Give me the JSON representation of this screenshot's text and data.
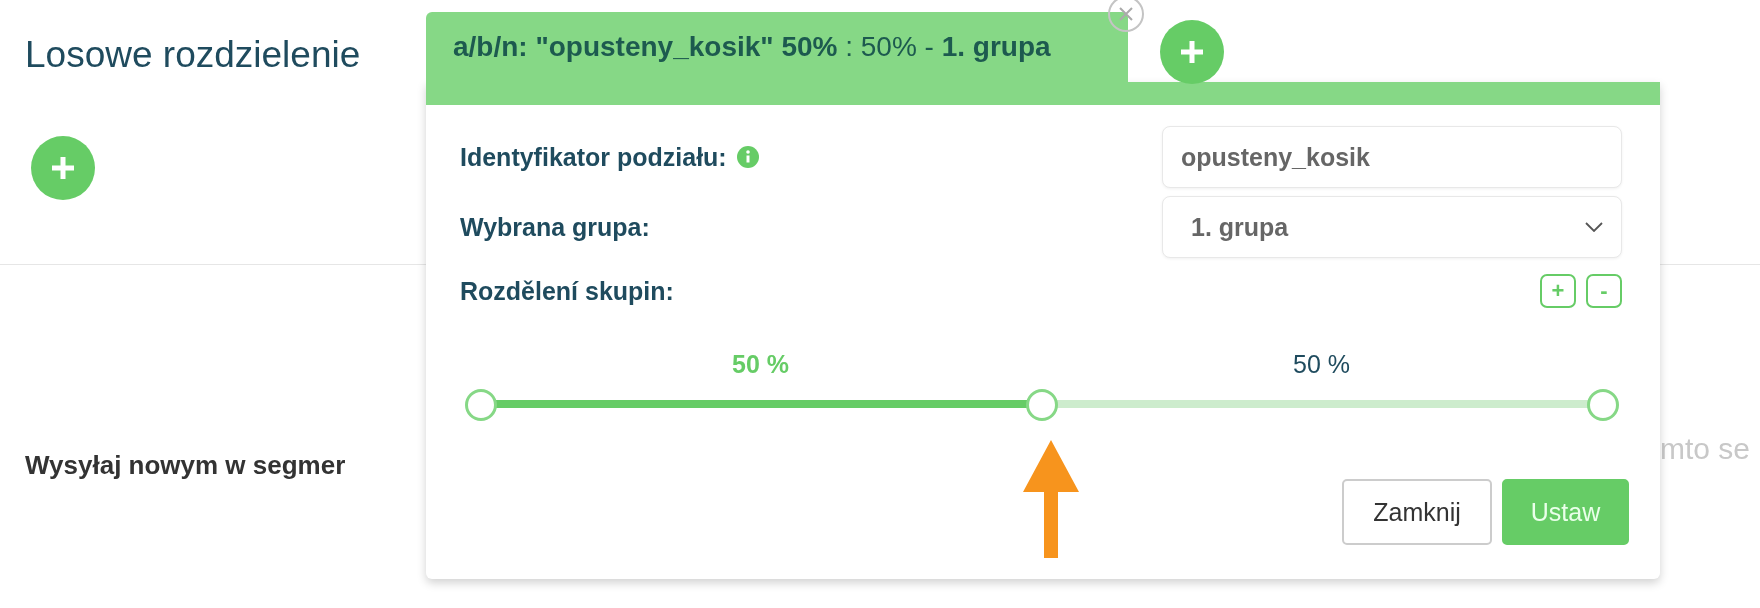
{
  "page": {
    "title": "Losowe rozdzielenie",
    "list_item": "Wysyłaj nowym w segmer",
    "side_text": "mto se"
  },
  "popup": {
    "tab_title": "**a/b/n: \"opusteny_kosik\" 50%** : 50% - **1. grupa**",
    "fields": [
      {
        "kind": "input",
        "label": "Identyfikator podziału:",
        "info": true,
        "value": "opusteny_kosik"
      },
      {
        "kind": "select",
        "label": "Wybrana grupa:",
        "info": false,
        "value": "1. grupa"
      }
    ],
    "split": {
      "label": "Rozdělení skupin:",
      "add": "+",
      "remove": "-",
      "groups": [
        {
          "label": "50 %",
          "selected": true,
          "level": 0.5
        },
        {
          "label": "50 %",
          "selected": false,
          "level": 0.5
        }
      ]
    },
    "buttons": [
      {
        "label": "Zamknij",
        "kind": "secondary"
      },
      {
        "label": "Ustaw",
        "kind": "primary"
      }
    ]
  }
}
